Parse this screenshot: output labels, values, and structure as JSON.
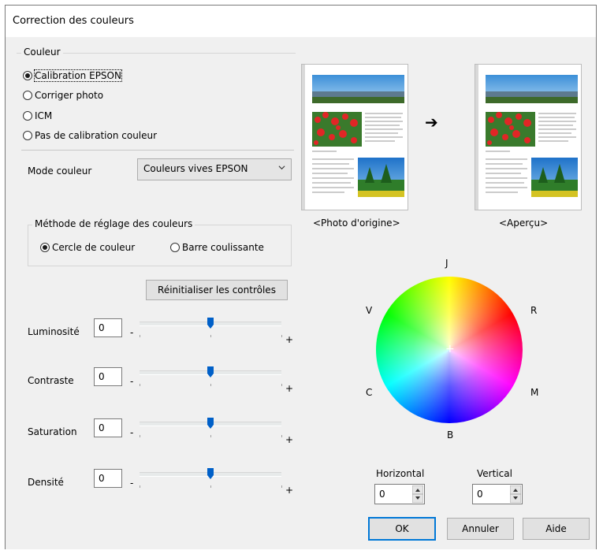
{
  "window": {
    "title": "Correction des couleurs"
  },
  "color_group": {
    "legend": "Couleur",
    "options": [
      {
        "label": "Calibration EPSON",
        "selected": true
      },
      {
        "label": "Corriger photo",
        "selected": false
      },
      {
        "label": "ICM",
        "selected": false
      },
      {
        "label": "Pas de calibration couleur",
        "selected": false
      }
    ]
  },
  "color_mode": {
    "label": "Mode couleur",
    "value": "Couleurs vives EPSON"
  },
  "adjust_method": {
    "legend": "Méthode de réglage des couleurs",
    "options": [
      {
        "label": "Cercle de couleur",
        "selected": true
      },
      {
        "label": "Barre coulissante",
        "selected": false
      }
    ]
  },
  "reset_button": "Réinitialiser les contrôles",
  "sliders": [
    {
      "label": "Luminosité",
      "value": "0",
      "level": 0.5
    },
    {
      "label": "Contraste",
      "value": "0",
      "level": 0.5
    },
    {
      "label": "Saturation",
      "value": "0",
      "level": 0.5
    },
    {
      "label": "Densité",
      "value": "0",
      "level": 0.5
    }
  ],
  "slider_signs": {
    "minus": "-",
    "plus": "+"
  },
  "previews": {
    "original": "<Photo d'origine>",
    "preview": "<Aperçu>",
    "arrow": "➔"
  },
  "wheel_labels": {
    "top": "J",
    "top_right": "R",
    "bottom_right": "M",
    "bottom": "B",
    "bottom_left": "C",
    "top_left": "V"
  },
  "wheel_center": "+",
  "spinners": {
    "horizontal": {
      "label": "Horizontal",
      "value": "0"
    },
    "vertical": {
      "label": "Vertical",
      "value": "0"
    }
  },
  "buttons": {
    "ok": "OK",
    "cancel": "Annuler",
    "help": "Aide"
  },
  "colors": {
    "accent": "#0078d7",
    "face": "#f0f0f0",
    "button": "#e1e1e1",
    "thumb": "#0060c8"
  }
}
